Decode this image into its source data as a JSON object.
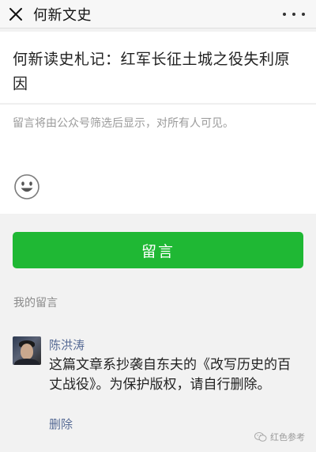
{
  "nav": {
    "title": "何新文史"
  },
  "article": {
    "title": "何新读史札记：红军长征土城之役失利原因"
  },
  "comment_box": {
    "placeholder": "留言将由公众号筛选后显示，对所有人可见。"
  },
  "submit": {
    "label": "留言"
  },
  "my_comments": {
    "section_label": "我的留言",
    "items": [
      {
        "name": "陈洪涛",
        "text": "这篇文章系抄袭自东夫的《改写历史的百丈战役》。为保护版权，请自行删除。",
        "action": "删除"
      }
    ]
  },
  "watermark": {
    "text": "红色参考"
  },
  "colors": {
    "accent_green": "#1fb834",
    "link_blue": "#576b95"
  },
  "icons": {
    "close": "close-icon",
    "more": "more-dots-icon",
    "emoji": "smiley-face-icon",
    "watermark": "wechat-logo-icon"
  }
}
